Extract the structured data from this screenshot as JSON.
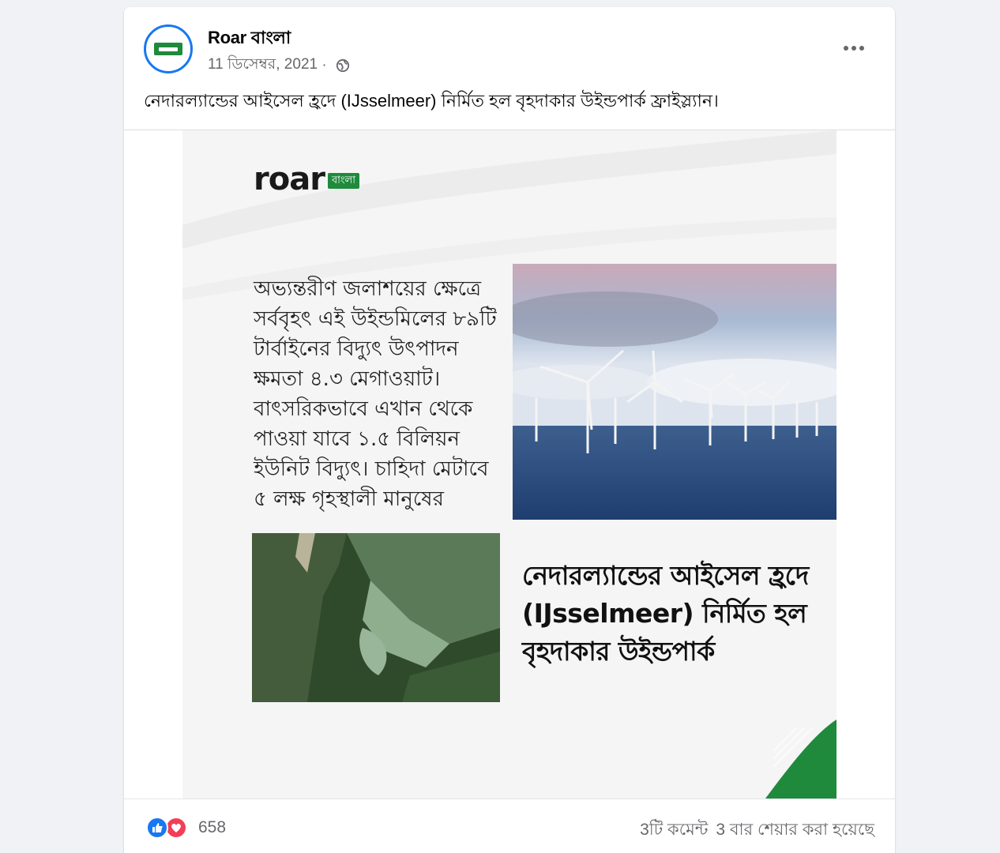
{
  "post": {
    "page_name": "Roar বাংলা",
    "date": "11 ডিসেম্বর, 2021",
    "separator": " · ",
    "caption": "নেদারল্যান্ডের আইসেল হ্রদে (IJsselmeer) নির্মিত হল বৃহদাকার উইন্ডপার্ক ফ্রাইস্ল্যান।"
  },
  "graphic": {
    "logo_word": "roar",
    "logo_badge": "বাংলা",
    "stat_text": "অভ্যন্তরীণ জলাশয়ের ক্ষেত্রে সর্ববৃহৎ এই উইন্ডমিলের ৮৯টি টার্বাইনের বিদ্যুৎ উৎপাদন ক্ষমতা ৪.৩ মেগাওয়াট। বাৎসরিকভাবে এখান থেকে পাওয়া যাবে ১.৫ বিলিয়ন ইউনিট বিদ্যুৎ। চাহিদা মেটাবে ৫ লক্ষ গৃহস্থালী মানুষের",
    "headline": "নেদারল্যান্ডের আইসেল হ্রদে (IJsselmeer) নির্মিত হল বৃহদাকার উইন্ডপার্ক"
  },
  "footer": {
    "reaction_count": "658",
    "comments": "3টি কমেন্ট",
    "shares": "3 বার শেয়ার করা হয়েছে"
  },
  "colors": {
    "brand_green": "#1f8a3c",
    "facebook_blue": "#1877f2",
    "love_red": "#f33e58"
  },
  "icons": [
    "globe-icon",
    "more-icon",
    "like-icon",
    "love-icon"
  ]
}
